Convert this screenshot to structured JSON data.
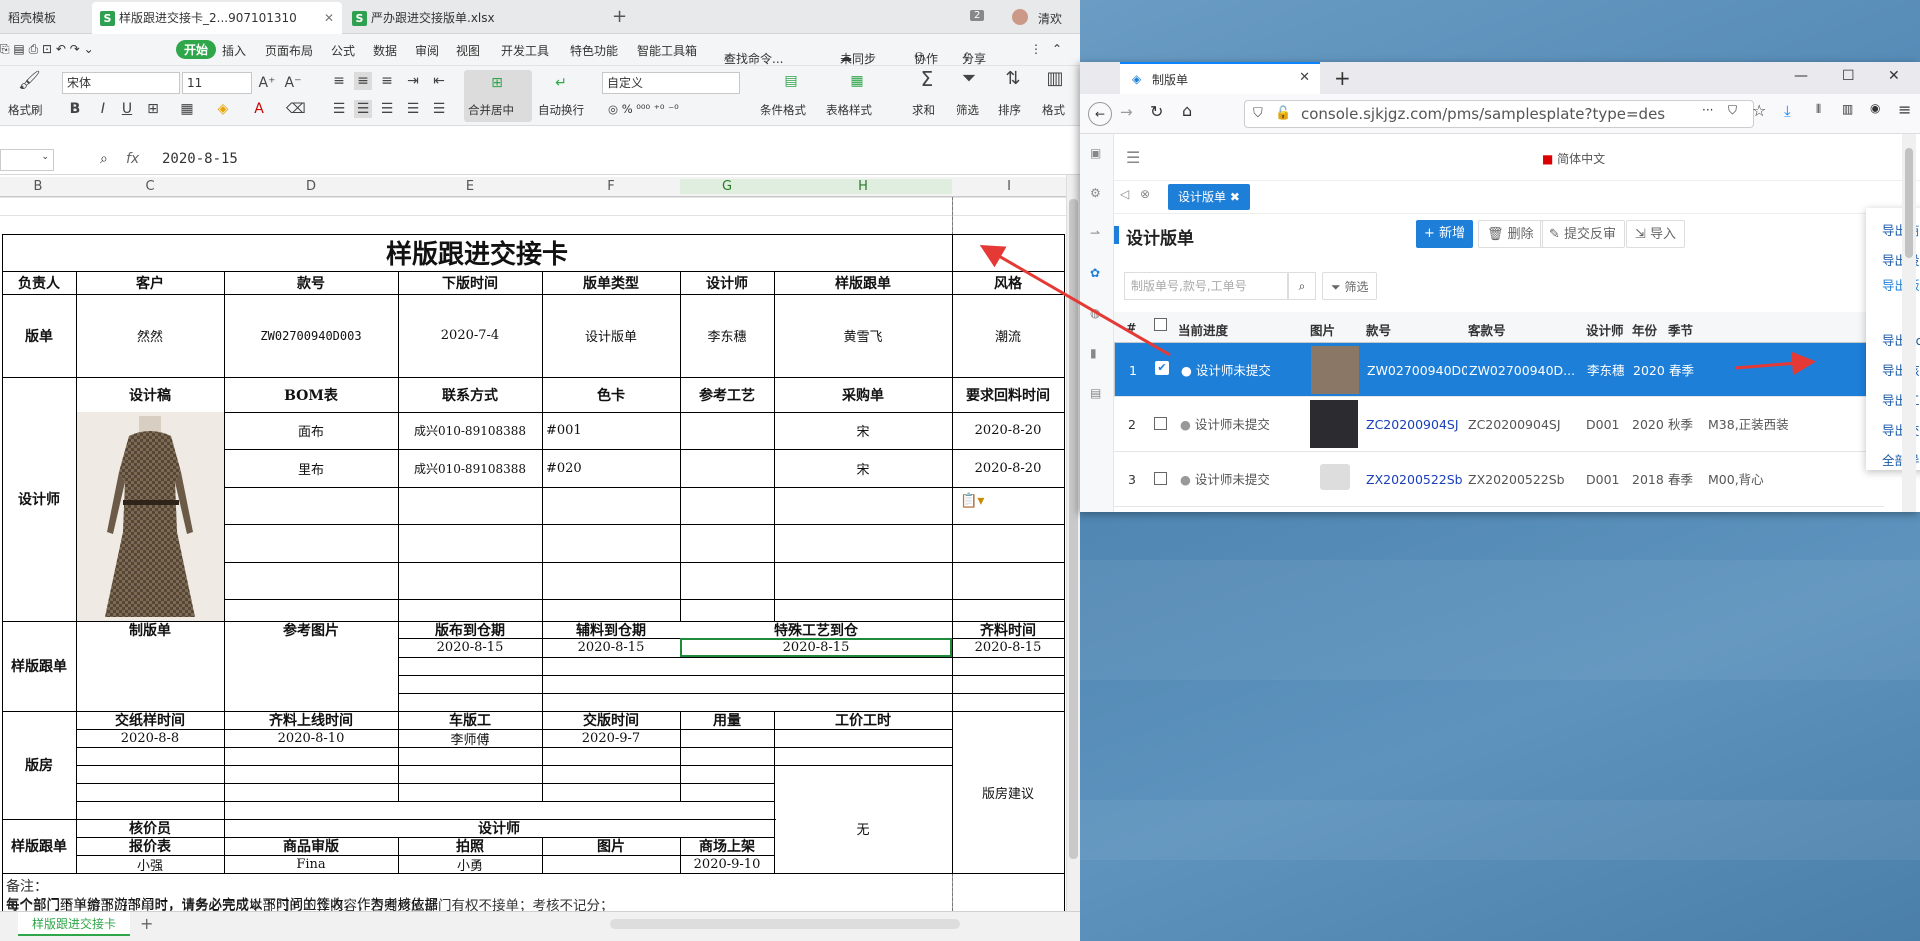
{
  "wps": {
    "tabs": [
      {
        "label": "稻壳模板"
      },
      {
        "label": "样版跟进交接卡_2...907101310"
      },
      {
        "label": "严办跟进交接版单.xlsx"
      }
    ],
    "tab_count": "2",
    "user_name": "清欢",
    "menu": [
      "开始",
      "插入",
      "页面布局",
      "公式",
      "数据",
      "审阅",
      "视图",
      "开发工具",
      "特色功能",
      "智能工具箱"
    ],
    "search_cmd": "查找命令...",
    "sync": "未同步",
    "collab": "协作",
    "share": "分享",
    "ribbon": {
      "format_painter": "格式刷",
      "font_name": "宋体",
      "font_size": "11",
      "merge": "合并居中",
      "wrap": "自动换行",
      "numfmt": "自定义",
      "cond_format": "条件格式",
      "table_style": "表格样式",
      "sum": "求和",
      "filter": "筛选",
      "sort": "排序",
      "format": "格式"
    },
    "formula_value": "2020-8-15",
    "fx": "fx",
    "columns": [
      "B",
      "C",
      "D",
      "E",
      "F",
      "G",
      "H",
      "I"
    ],
    "sheet_tab": "样版跟进交接卡"
  },
  "card": {
    "title": "样版跟进交接卡",
    "r1": [
      "负责人",
      "客户",
      "款号",
      "下版时间",
      "版单类型",
      "设计师",
      "样版跟单",
      "风格"
    ],
    "r2": [
      "版单",
      "然然",
      "ZW02700940D003",
      "2020-7-4",
      "设计版单",
      "李东穗",
      "黄雪飞",
      "潮流"
    ],
    "r3": [
      "设计师",
      "设计稿",
      "BOM表",
      "联系方式",
      "色卡",
      "参考工艺",
      "采购单",
      "要求回料时间"
    ],
    "bom1": [
      "面布",
      "成兴010-89108388",
      "#001",
      "",
      "宋",
      "2020-8-20"
    ],
    "bom2": [
      "里布",
      "成兴010-89108388",
      "#020",
      "",
      "宋",
      "2020-8-20"
    ],
    "r4h": [
      "样版跟单",
      "制版单",
      "参考图片",
      "版布到仓期",
      "辅料到仓期",
      "特殊工艺到仓",
      "齐料时间"
    ],
    "r4v": [
      "2020-8-15",
      "2020-8-15",
      "2020-8-15",
      "2020-8-15"
    ],
    "r5h": [
      "版房",
      "交纸样时间",
      "齐料上线时间",
      "车版工",
      "交版时间",
      "用量",
      "工价工时"
    ],
    "r5v": [
      "2020-8-8",
      "2020-8-10",
      "李师傅",
      "2020-9-7"
    ],
    "r5note": "版房建议",
    "r6h": [
      "样版跟单",
      "核价员",
      "设计师"
    ],
    "r6h2": [
      "报价表",
      "商品审版",
      "拍照",
      "图片",
      "商场上架"
    ],
    "r6v": [
      "小强",
      "Fina",
      "小勇",
      "",
      "2020-9-10"
    ],
    "none": "无",
    "remark_title": "备注：",
    "remark1": "每个部门给下游部门下单时，请务必完成本部门的工作内容，否则对应部门有权不接单；考核不记分；",
    "remark2": "每个部门下单给下游部门时，请务必完成以下时间的签收，作为考核依据"
  },
  "browser": {
    "tab_title": "制版单",
    "url": "console.sjkjgz.com/pms/samplesplate?type=des",
    "lang": "简体中文",
    "active_tab": "设计版单",
    "page_title": "设计版单",
    "btn_new": "+ 新增",
    "btn_delete": "删除",
    "btn_submit": "提交反审",
    "btn_import": "导入",
    "search_placeholder": "制版单号,款号,工单号",
    "filter": "筛选",
    "headers": [
      "#",
      "当前进度",
      "图片",
      "款号",
      "客款号",
      "设计师",
      "年份",
      "季节"
    ],
    "rows": [
      {
        "n": "1",
        "status": "设计师未提交",
        "code": "ZW02700940D003",
        "cust": "ZW02700940D...",
        "designer": "李东穗",
        "year": "2020",
        "season": "春季",
        "extra": ""
      },
      {
        "n": "2",
        "status": "设计师未提交",
        "code": "ZC20200904SJ",
        "cust": "ZC20200904SJ",
        "designer": "D001",
        "year": "2020",
        "season": "秋季",
        "extra": "M38,正装西装"
      },
      {
        "n": "3",
        "status": "设计师未提交",
        "code": "ZX20200522Sb",
        "cust": "ZX20200522Sb",
        "designer": "D001",
        "year": "2018",
        "season": "春季",
        "extra": "M00,背心"
      }
    ],
    "menu": [
      "导出商城模板",
      "导出设计版单",
      "导出版布采购单",
      "导出Bom表",
      "导出核算单",
      "导出工艺单",
      "导出交接表",
      "全部导出"
    ]
  },
  "colors": {
    "wps_green": "#2fa64a",
    "ff_blue": "#1e7fd9",
    "arrow_red": "#e53935"
  }
}
